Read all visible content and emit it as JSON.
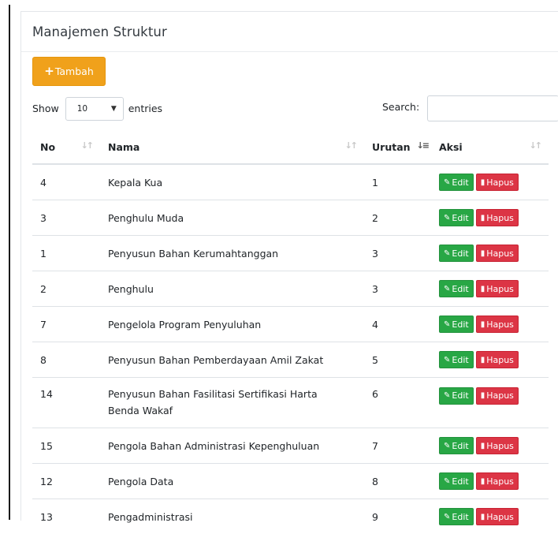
{
  "card": {
    "title": "Manajemen Struktur"
  },
  "toolbar": {
    "add_label": "Tambah"
  },
  "length": {
    "prefix": "Show",
    "value": "10",
    "suffix": "entries"
  },
  "search": {
    "label": "Search:",
    "value": ""
  },
  "table": {
    "columns": [
      {
        "label": "No",
        "sort": "both"
      },
      {
        "label": "Nama",
        "sort": "both"
      },
      {
        "label": "Urutan",
        "sort": "asc"
      },
      {
        "label": "Aksi",
        "sort": "both"
      }
    ],
    "rows": [
      {
        "no": "4",
        "nama": "Kepala Kua",
        "urutan": "1"
      },
      {
        "no": "3",
        "nama": "Penghulu Muda",
        "urutan": "2"
      },
      {
        "no": "1",
        "nama": "Penyusun Bahan Kerumahtanggan",
        "urutan": "3"
      },
      {
        "no": "2",
        "nama": "Penghulu",
        "urutan": "3"
      },
      {
        "no": "7",
        "nama": "Pengelola Program Penyuluhan",
        "urutan": "4"
      },
      {
        "no": "8",
        "nama": "Penyusun Bahan Pemberdayaan Amil Zakat",
        "urutan": "5"
      },
      {
        "no": "14",
        "nama": "Penyusun Bahan Fasilitasi Sertifikasi Harta Benda Wakaf",
        "urutan": "6"
      },
      {
        "no": "15",
        "nama": "Pengola Bahan Administrasi Kepenghuluan",
        "urutan": "7"
      },
      {
        "no": "12",
        "nama": "Pengola Data",
        "urutan": "8"
      },
      {
        "no": "13",
        "nama": "Pengadministrasi",
        "urutan": "9"
      }
    ],
    "edit_label": "Edit",
    "delete_label": "Hapus"
  },
  "colors": {
    "add_button": "#f0a11b",
    "edit_button": "#28a745",
    "delete_button": "#dc3545"
  },
  "icons": {
    "add": "plus-icon",
    "edit": "edit-icon",
    "delete": "trash-icon",
    "sort": "sort-icon",
    "dropdown": "chevron-down-icon"
  }
}
